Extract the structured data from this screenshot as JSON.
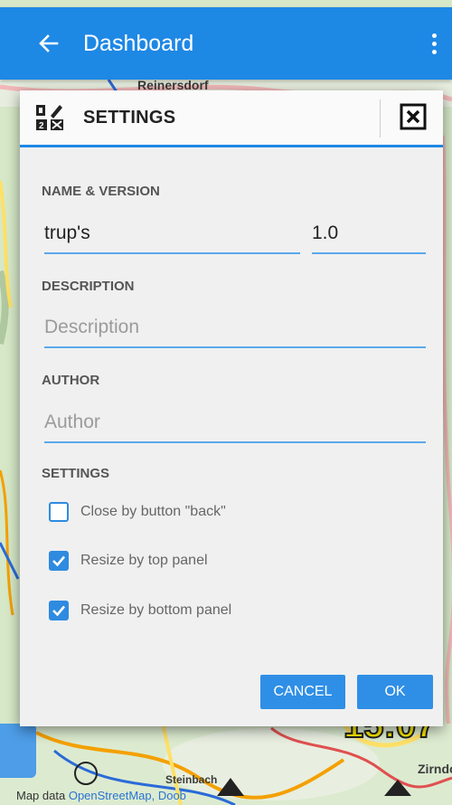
{
  "app_bar": {
    "title": "Dashboard",
    "background": "#1e88e5"
  },
  "map": {
    "labels": [
      "Reinersdorf",
      "Steinbach",
      "Zirndo"
    ],
    "clock": "15:07",
    "attribution_prefix": "Map data ",
    "attribution_link": "OpenStreetMap, Doob"
  },
  "dialog": {
    "title": "SETTINGS",
    "name_version": {
      "section_label": "NAME & VERSION",
      "name_value": "trup's",
      "version_value": "1.0"
    },
    "description": {
      "section_label": "DESCRIPTION",
      "placeholder": "Description",
      "value": ""
    },
    "author": {
      "section_label": "AUTHOR",
      "placeholder": "Author",
      "value": ""
    },
    "settings": {
      "section_label": "SETTINGS",
      "options": [
        {
          "label": "Close by button \"back\"",
          "checked": false
        },
        {
          "label": "Resize by top panel",
          "checked": true
        },
        {
          "label": "Resize by bottom panel",
          "checked": true
        }
      ]
    },
    "buttons": {
      "cancel": "CANCEL",
      "ok": "OK"
    },
    "accent_color": "#2e8be0"
  }
}
